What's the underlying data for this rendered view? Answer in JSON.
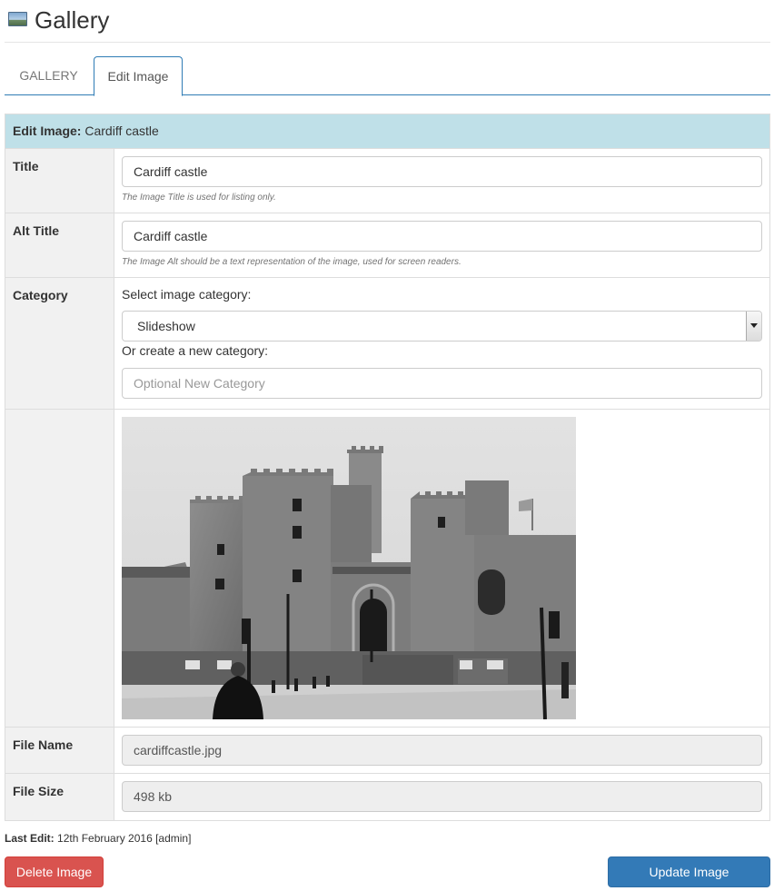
{
  "header": {
    "title": "Gallery",
    "icon": "image-icon"
  },
  "tabs": [
    {
      "label": "GALLERY",
      "active": false
    },
    {
      "label": "Edit Image",
      "active": true
    }
  ],
  "form": {
    "heading_label": "Edit Image:",
    "heading_value": "Cardiff castle",
    "title": {
      "label": "Title",
      "value": "Cardiff castle",
      "help": "The Image Title is used for listing only."
    },
    "alt_title": {
      "label": "Alt Title",
      "value": "Cardiff castle",
      "help": "The Image Alt should be a text representation of the image, used for screen readers."
    },
    "category": {
      "label": "Category",
      "select_prompt": "Select image category:",
      "selected": "Slideshow",
      "new_prompt": "Or create a new category:",
      "new_placeholder": "Optional New Category"
    },
    "file_name": {
      "label": "File Name",
      "value": "cardiffcastle.jpg"
    },
    "file_size": {
      "label": "File Size",
      "value": "498 kb"
    }
  },
  "last_edit": {
    "label": "Last Edit:",
    "value": "12th February 2016 [admin]"
  },
  "buttons": {
    "delete": "Delete Image",
    "update": "Update Image"
  },
  "colors": {
    "primary": "#337ab7",
    "danger": "#d9534f",
    "panel_header": "#bfe0e8"
  }
}
